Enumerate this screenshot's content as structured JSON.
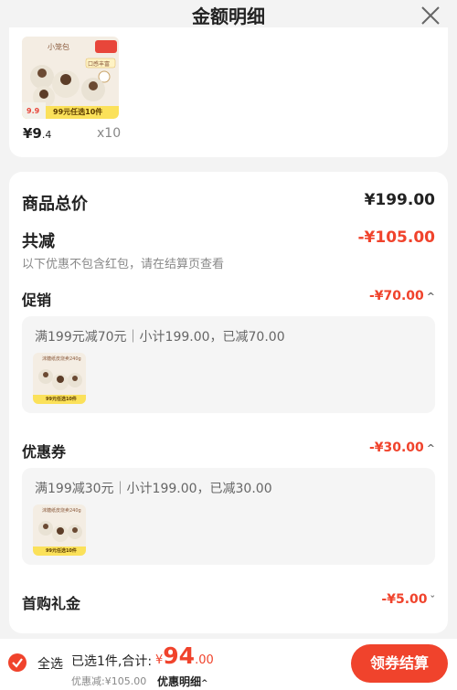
{
  "header": {
    "title": "金额明细",
    "close_icon": "close-icon"
  },
  "product": {
    "price_int": "¥9",
    "price_dec": ".4",
    "quantity": "x10",
    "badge_price": "9.9",
    "badge_text": "99元任选10件",
    "package_label": "小笼包",
    "package_label_sub": "口感丰富"
  },
  "summary": {
    "total_label": "商品总价",
    "total_value": "¥199.00",
    "reduce_label": "共减",
    "reduce_value": "-¥105.00",
    "reduce_note": "以下优惠不包含红包，请在结算页查看"
  },
  "promotions": [
    {
      "label": "促销",
      "value": "-¥70.00",
      "chevron": "^",
      "desc": "满199元减70元｜小计199.00，已减70.00",
      "thumb_text": "99元任选10件",
      "thumb_title": "沫糖纸皮烧卖240g"
    },
    {
      "label": "优惠券",
      "value": "-¥30.00",
      "chevron": "^",
      "desc": "满199减30元｜小计199.00，已减30.00",
      "thumb_text": "99元任选10件",
      "thumb_title": "沫糖纸皮烧卖240g"
    },
    {
      "label": "首购礼金",
      "value": "-¥5.00",
      "chevron": "ˇ"
    }
  ],
  "footer": {
    "select_all": "全选",
    "selected": "已选1件,合计:",
    "currency": "¥",
    "total_int": "94",
    "total_dec": ".00",
    "discount": "优惠减:¥105.00",
    "detail_label": "优惠明细",
    "detail_chevron": "^",
    "checkout_button": "领券结算"
  },
  "colors": {
    "accent": "#f0432c",
    "background": "#f3f3f3"
  }
}
